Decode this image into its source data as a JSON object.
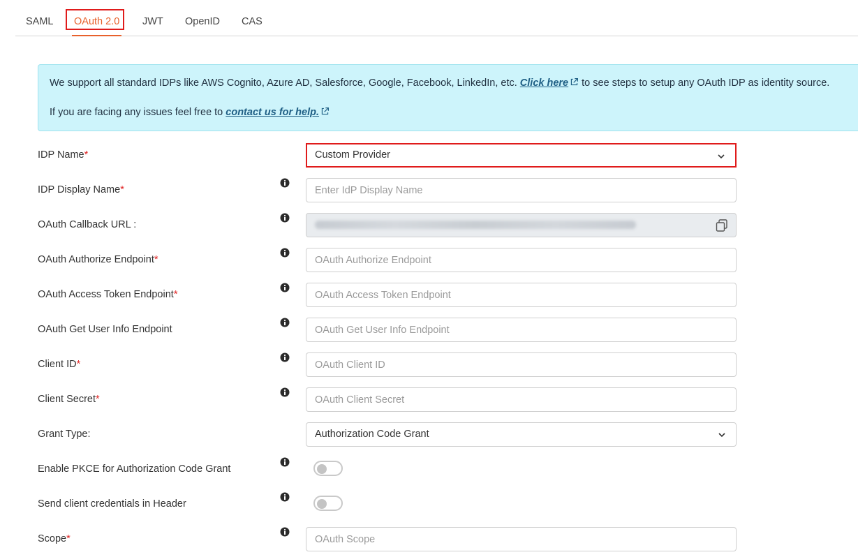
{
  "tabs": [
    {
      "label": "SAML"
    },
    {
      "label": "OAuth 2.0"
    },
    {
      "label": "JWT"
    },
    {
      "label": "OpenID"
    },
    {
      "label": "CAS"
    }
  ],
  "active_tab": "OAuth 2.0",
  "notice": {
    "line1_prefix": "We support all standard IDPs like AWS Cognito, Azure AD, Salesforce, Google, Facebook, LinkedIn, etc.",
    "line1_link": "Click here",
    "line1_suffix": "to see steps to setup any OAuth IDP as identity source.",
    "line2_prefix": "If you are facing any issues feel free to",
    "line2_link": "contact us for help."
  },
  "form": {
    "idp_name": {
      "label": "IDP Name",
      "required": "*",
      "value": "Custom Provider"
    },
    "idp_display_name": {
      "label": "IDP Display Name",
      "required": "*",
      "placeholder": "Enter IdP Display Name"
    },
    "callback_url": {
      "label": "OAuth Callback URL :"
    },
    "authorize_endpoint": {
      "label": "OAuth Authorize Endpoint",
      "required": "*",
      "placeholder": "OAuth Authorize Endpoint"
    },
    "token_endpoint": {
      "label": "OAuth Access Token Endpoint",
      "required": "*",
      "placeholder": "OAuth Access Token Endpoint"
    },
    "userinfo_endpoint": {
      "label": "OAuth Get User Info Endpoint",
      "placeholder": "OAuth Get User Info Endpoint"
    },
    "client_id": {
      "label": "Client ID",
      "required": "*",
      "placeholder": "OAuth Client ID"
    },
    "client_secret": {
      "label": "Client Secret",
      "required": "*",
      "placeholder": "OAuth Client Secret"
    },
    "grant_type": {
      "label": "Grant Type:",
      "value": "Authorization Code Grant"
    },
    "pkce": {
      "label": "Enable PKCE for Authorization Code Grant",
      "enabled": false
    },
    "creds_header": {
      "label": "Send client credentials in Header",
      "enabled": false
    },
    "scope": {
      "label": "Scope",
      "required": "*",
      "placeholder": "OAuth Scope"
    }
  },
  "colors": {
    "accent": "#e8612c",
    "highlight": "#e01b1b",
    "required": "#e02424",
    "notice_bg": "#cdf4fb"
  }
}
